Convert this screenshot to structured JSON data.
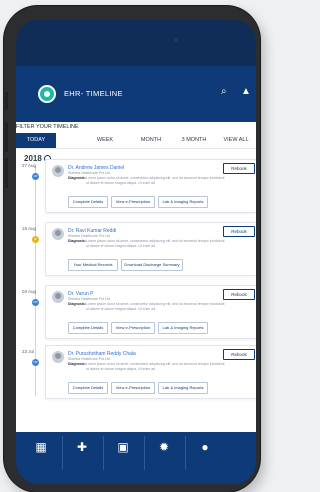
{
  "app": {
    "title": "EHR- TIMELINE",
    "filter_label": "FILTER YOUR TIMELINE"
  },
  "tabs": [
    {
      "label": "TODAY",
      "active": true
    },
    {
      "label": "WEEK",
      "active": false
    },
    {
      "label": "MONTH",
      "active": false
    },
    {
      "label": "3 MONTH",
      "active": false
    },
    {
      "label": "VIEW ALL",
      "active": false
    }
  ],
  "year": "2018",
  "colors": {
    "brand": "#0f3a78",
    "teal": "#1fb7a6",
    "link": "#2f6fd1",
    "dot_blue": "#3b82d6",
    "dot_yellow": "#e7b21c"
  },
  "entries": [
    {
      "date": "27 Aug",
      "dot_color": "#3b82d6",
      "doctor": "Dr. Andrew James Daniel",
      "hospital": "Sheeba Healthcare Pvt Ltd",
      "diagnosis_label": "Diagnosis:",
      "diagnosis": "Lorem ipsum dolor sit amet, consectetur adipiscing elit, sed do eiusmod tempor incididunt ut labore et dolore magna aliqua. Ut enim ad",
      "rebook": "Rebook",
      "actions": [
        "Complete Details",
        "View e-Prescription",
        "Lab & Imaging Reports"
      ]
    },
    {
      "date": "18 Aug",
      "dot_color": "#e7b21c",
      "doctor": "Dr. Ravi Kumar Reddi",
      "hospital": "Sheeba Healthcare Pvt Ltd",
      "diagnosis_label": "Diagnosis:",
      "diagnosis": "Lorem ipsum dolor sit amet, consectetur adipiscing elit, sed do eiusmod tempor incididunt ut labore et dolore magna aliqua. Ut enim ad",
      "rebook": "Rebook",
      "actions": [
        "Your Medical Records",
        "Download Discharge Summary"
      ]
    },
    {
      "date": "03 Aug",
      "dot_color": "#3b82d6",
      "doctor": "Dr. Varun P",
      "hospital": "Sheeba Healthcare Pvt Ltd",
      "diagnosis_label": "Diagnosis:",
      "diagnosis": "Lorem ipsum dolor sit amet, consectetur adipiscing elit, sed do eiusmod tempor incididunt ut labore et dolore magna aliqua. Ut enim ad",
      "rebook": "Rebook",
      "actions": [
        "Complete Details",
        "View e-Prescription",
        "Lab & Imaging Reports"
      ]
    },
    {
      "date": "23 Jul",
      "dot_color": "#3b82d6",
      "doctor": "Dr. Purushotham Reddy Chala",
      "hospital": "Sheeba Healthcare Pvt Ltd",
      "diagnosis_label": "Diagnosis:",
      "diagnosis": "Lorem ipsum dolor sit amet, consectetur adipiscing elit, sed do eiusmod tempor incididunt ut labore et dolore magna aliqua. Ut enim ad",
      "rebook": "Rebook",
      "actions": [
        "Complete Details",
        "View e-Prescription",
        "Lab & Imaging Reports"
      ]
    }
  ],
  "bottom_nav": [
    {
      "icon": "dashboard-icon",
      "glyph": "▦"
    },
    {
      "icon": "add-record-icon",
      "glyph": "✚"
    },
    {
      "icon": "calendar-icon",
      "glyph": "▣"
    },
    {
      "icon": "settings-icon",
      "glyph": "✹"
    },
    {
      "icon": "profile-icon",
      "glyph": "●"
    }
  ]
}
